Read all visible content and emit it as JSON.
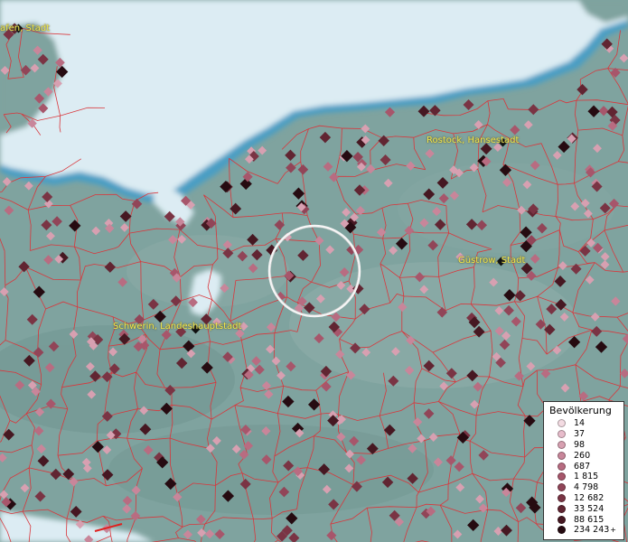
{
  "map": {
    "cities": [
      {
        "name": "Rostock, Hansestadt",
        "dot": true
      },
      {
        "name": "Güstrow, Stadt",
        "dot": true
      },
      {
        "name": "Schwerin, Landeshauptstadt",
        "dot": true
      },
      {
        "name": "afen, Stadt",
        "dot": true
      }
    ],
    "colors": {
      "sea": "#dcecf3",
      "land": "#7fa39f",
      "borders": "#d9363b"
    }
  },
  "legend": {
    "title": "Bevölkerung",
    "items": [
      {
        "label": "14",
        "color": "#f3dbe2"
      },
      {
        "label": "37",
        "color": "#e7bccb"
      },
      {
        "label": "98",
        "color": "#d7a0b1"
      },
      {
        "label": "260",
        "color": "#c8869a"
      },
      {
        "label": "687",
        "color": "#b86c81"
      },
      {
        "label": "1 815",
        "color": "#a7566b"
      },
      {
        "label": "4 798",
        "color": "#914558"
      },
      {
        "label": "12 682",
        "color": "#7a3444"
      },
      {
        "label": "33 524",
        "color": "#612532"
      },
      {
        "label": "88 615",
        "color": "#461822"
      },
      {
        "label": "234 243",
        "color": "#260b11",
        "plus": "+"
      }
    ]
  }
}
